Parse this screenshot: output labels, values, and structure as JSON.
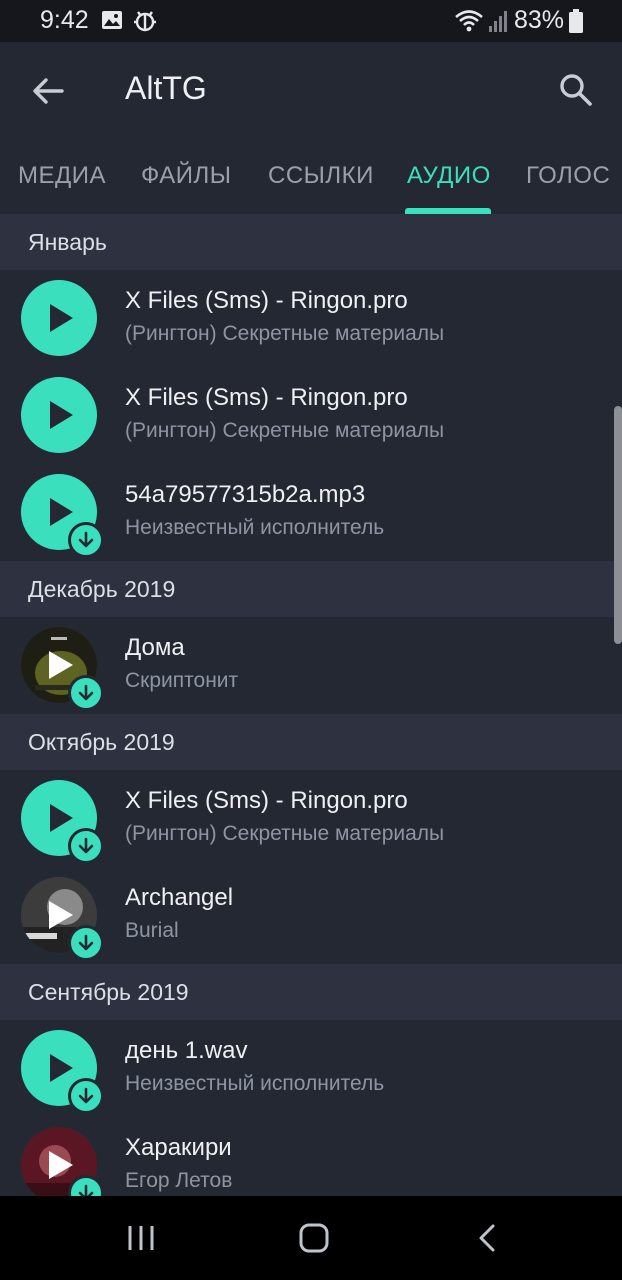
{
  "status_bar": {
    "time": "9:42",
    "battery": "83%",
    "icons": [
      "image-icon",
      "bug-icon",
      "wifi-icon",
      "signal-icon",
      "battery-icon"
    ]
  },
  "app_bar": {
    "title": "AltTG",
    "back_icon": "arrow-left-icon",
    "search_icon": "search-icon"
  },
  "tabs": [
    {
      "label": "МЕДИА",
      "active": false
    },
    {
      "label": "ФАЙЛЫ",
      "active": false
    },
    {
      "label": "ССЫЛКИ",
      "active": false
    },
    {
      "label": "АУДИО",
      "active": true
    },
    {
      "label": "ГОЛОС",
      "active": false
    }
  ],
  "sections": [
    {
      "header": "Январь",
      "items": [
        {
          "title": "X Files (Sms) - Ringon.pro",
          "subtitle": "(Рингтон) Секретные материалы",
          "cover": false,
          "download": false
        },
        {
          "title": "X Files (Sms) - Ringon.pro",
          "subtitle": "(Рингтон) Секретные материалы",
          "cover": false,
          "download": false
        },
        {
          "title": "54a79577315b2a.mp3",
          "subtitle": "Неизвестный исполнитель",
          "cover": false,
          "download": true
        }
      ]
    },
    {
      "header": "Декабрь 2019",
      "items": [
        {
          "title": "Дома",
          "subtitle": "Скриптонит",
          "cover": true,
          "download": true
        }
      ]
    },
    {
      "header": "Октябрь 2019",
      "items": [
        {
          "title": "X Files (Sms) - Ringon.pro",
          "subtitle": "(Рингтон) Секретные материалы",
          "cover": false,
          "download": true
        },
        {
          "title": "Archangel",
          "subtitle": "Burial",
          "cover": true,
          "download": true
        }
      ]
    },
    {
      "header": "Сентябрь 2019",
      "items": [
        {
          "title": "день 1.wav",
          "subtitle": "Неизвестный исполнитель",
          "cover": false,
          "download": true
        },
        {
          "title": "Харакири",
          "subtitle": "Егор Летов",
          "cover": true,
          "download": true
        }
      ]
    }
  ],
  "colors": {
    "accent": "#3ae0bd",
    "background": "#242833",
    "section_header": "#2d3140"
  }
}
